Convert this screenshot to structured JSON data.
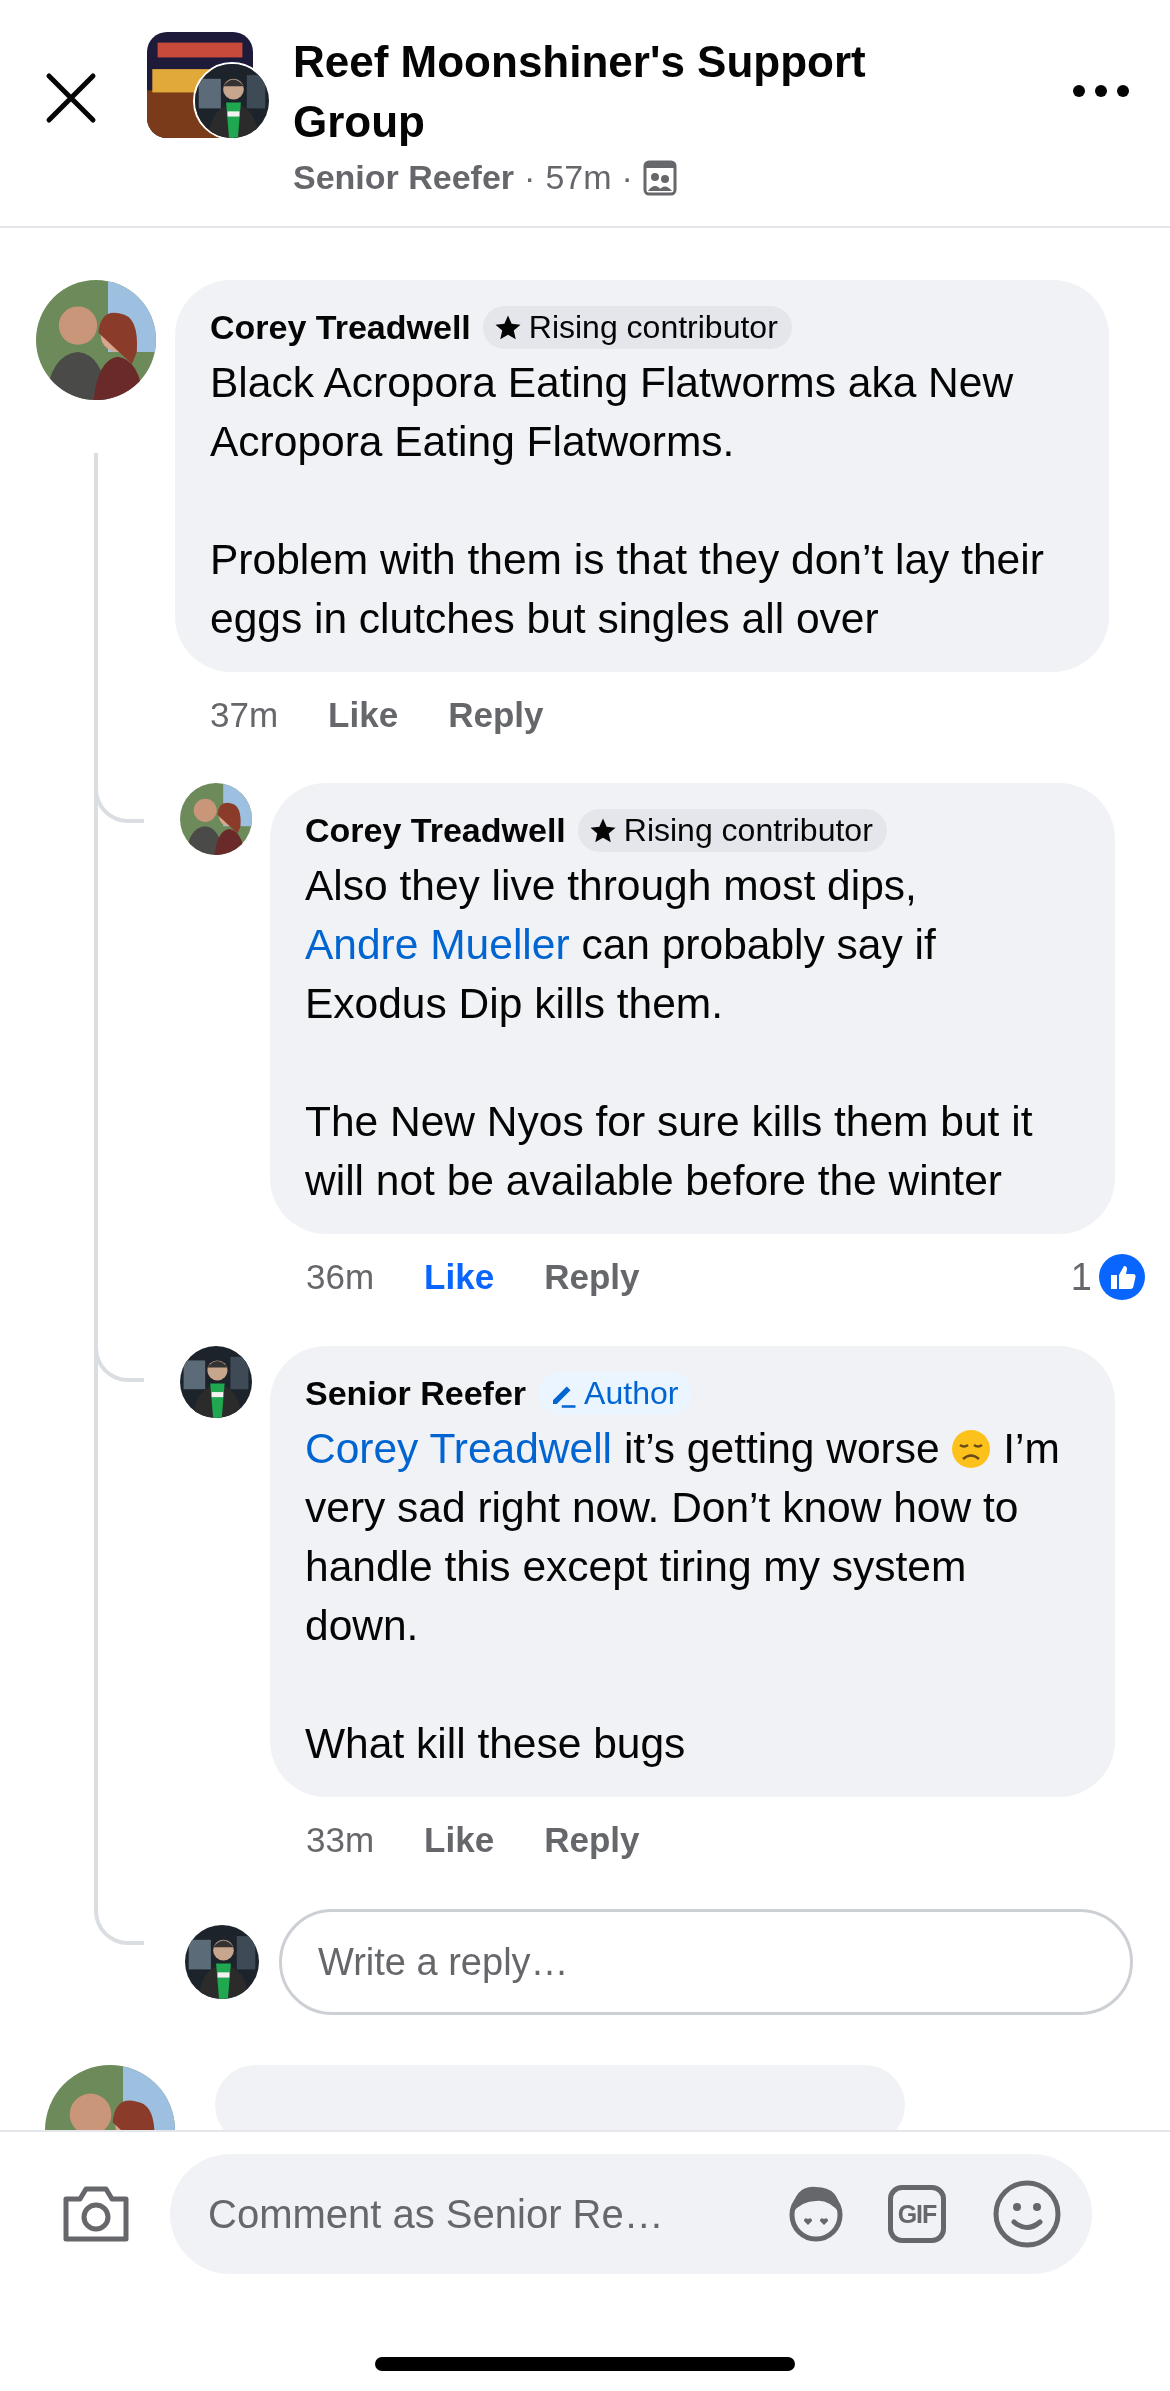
{
  "header": {
    "title": "Reef Moonshiner's Support Group",
    "author": "Senior Reefer",
    "dot_1": "·",
    "time": "57m",
    "dot_2": "·"
  },
  "comments": [
    {
      "author": "Corey Treadwell",
      "badge": {
        "kind": "contributor",
        "label": "Rising contributor"
      },
      "paragraphs": [
        [
          {
            "text": "Black Acropora Eating Flatworms aka New Acropora Eating Flatworms."
          }
        ],
        [
          {
            "text": "Problem with them is that they don’t lay their eggs in clutches but singles all over"
          }
        ]
      ],
      "time": "37m",
      "like": "Like",
      "liked": false,
      "reply": "Reply",
      "replies": [
        {
          "author": "Corey Treadwell",
          "badge": {
            "kind": "contributor",
            "label": "Rising contributor"
          },
          "paragraphs": [
            [
              {
                "text": "Also they live through most dips, "
              },
              {
                "mention": "Andre Mueller"
              },
              {
                "text": " can probably say if Exodus Dip kills them."
              }
            ],
            [
              {
                "text": "The New Nyos for sure kills them but it will not be available before the winter"
              }
            ]
          ],
          "time": "36m",
          "like": "Like",
          "liked": true,
          "reply": "Reply",
          "reaction_count": "1"
        },
        {
          "author": "Senior Reefer",
          "badge": {
            "kind": "author",
            "label": "Author"
          },
          "paragraphs": [
            [
              {
                "mention": "Corey Treadwell"
              },
              {
                "text": " it’s getting worse "
              },
              {
                "kind": "emoji"
              },
              {
                "text": " I’m very sad right now. Don’t know how to handle this except tiring my system down."
              }
            ],
            [
              {
                "text": "What kill these bugs"
              }
            ]
          ],
          "time": "33m",
          "like": "Like",
          "liked": false,
          "reply": "Reply"
        }
      ],
      "reply_field": {
        "placeholder": "Write a reply…"
      }
    }
  ],
  "composer": {
    "placeholder": "Comment as Senior Re…",
    "gif_label": "GIF"
  }
}
